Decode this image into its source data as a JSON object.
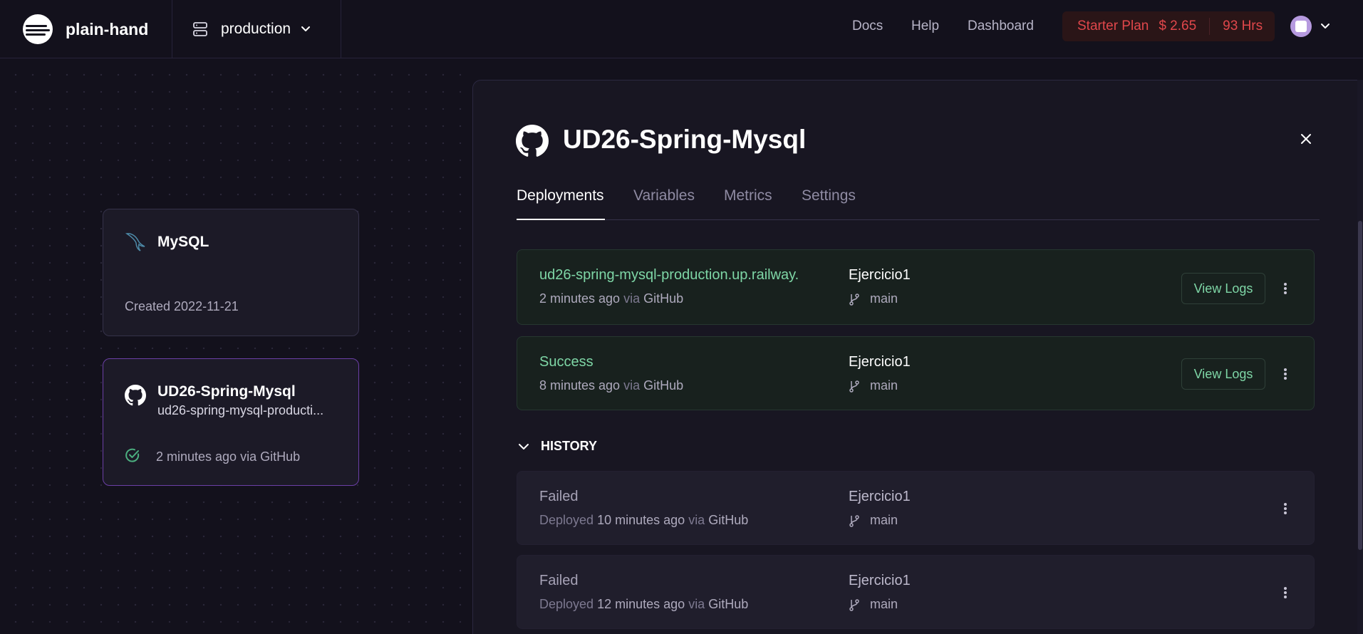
{
  "topbar": {
    "project_name": "plain-hand",
    "environment": "production",
    "nav": [
      "Docs",
      "Help",
      "Dashboard"
    ],
    "plan": {
      "name": "Starter Plan",
      "cost": "$ 2.65",
      "hours": "93 Hrs",
      "color": "#e0474b"
    }
  },
  "canvas": {
    "services": [
      {
        "name": "MySQL",
        "icon": "mysql-dolphin-icon",
        "meta": "Created 2022-11-21"
      },
      {
        "name": "UD26-Spring-Mysql",
        "icon": "github-icon",
        "subtitle": "ud26-spring-mysql-producti...",
        "status_icon": "check-circle-icon",
        "meta": "2 minutes ago via GitHub",
        "selected": true
      }
    ]
  },
  "panel": {
    "title": "UD26-Spring-Mysql",
    "tabs": [
      "Deployments",
      "Variables",
      "Metrics",
      "Settings"
    ],
    "active_tab": "Deployments",
    "deployments": [
      {
        "status": "ud26-spring-mysql-production.up.railway.",
        "time": "2 minutes ago",
        "via": "via",
        "source": "GitHub",
        "commit": "Ejercicio1",
        "branch": "main",
        "action": "View Logs"
      },
      {
        "status": "Success",
        "time": "8 minutes ago",
        "via": "via",
        "source": "GitHub",
        "commit": "Ejercicio1",
        "branch": "main",
        "action": "View Logs"
      }
    ],
    "history_label": "HISTORY",
    "history": [
      {
        "status": "Failed",
        "deployed_label": "Deployed",
        "time": "10 minutes ago",
        "via": "via",
        "source": "GitHub",
        "commit": "Ejercicio1",
        "branch": "main"
      },
      {
        "status": "Failed",
        "deployed_label": "Deployed",
        "time": "12 minutes ago",
        "via": "via",
        "source": "GitHub",
        "commit": "Ejercicio1",
        "branch": "main"
      }
    ]
  },
  "colors": {
    "success_green": "#7ed6a6",
    "failed_gray": "#a6a2b6",
    "selected_border": "#6b3fa6"
  }
}
